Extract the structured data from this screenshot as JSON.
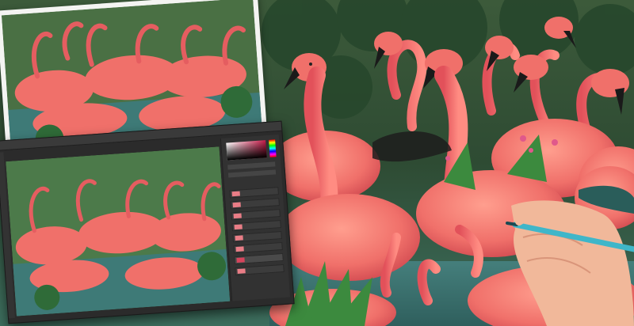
{
  "scene": {
    "description_tags": [
      "flamingo-flock",
      "printed-photo",
      "image-editor-window",
      "hand-with-pen"
    ],
    "colors": {
      "flamingo": "#f0786f",
      "flamingo_dark": "#d8484e",
      "water": "#3f7c78",
      "foliage": "#2f6b38",
      "pen": "#3fb6c9",
      "skin": "#f1b89a"
    }
  },
  "editor": {
    "layers_count_visible": 8,
    "active_layer_index": 6
  }
}
